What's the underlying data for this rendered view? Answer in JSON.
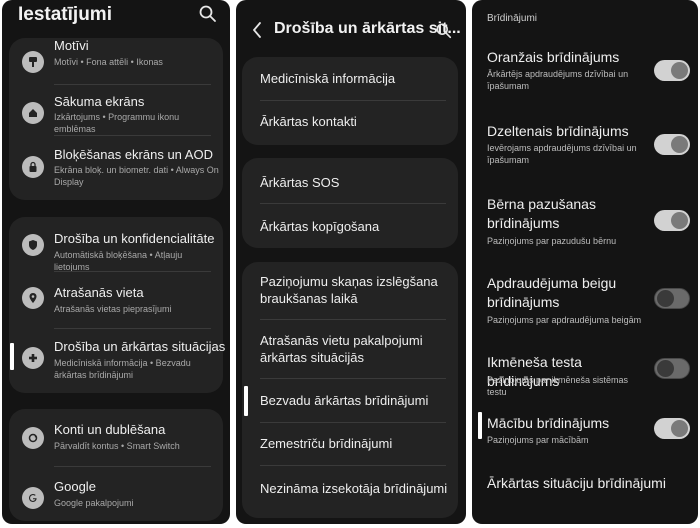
{
  "panel1": {
    "header": "Iestatījumi",
    "items": [
      {
        "title": "Motīvi",
        "sub": "Motīvi  •  Fona attēli  •  Ikonas"
      },
      {
        "title": "Sākuma ekrāns",
        "sub": "Izkārtojums  •  Programmu ikonu emblēmas"
      },
      {
        "title": "Bloķēšanas ekrāns un AOD",
        "sub": "Ekrāna bloķ. un biometr. dati  •  Always On Display"
      },
      {
        "title": "Drošība un konfidencialitāte",
        "sub": "Automātiskā bloķēšana  •  Atļauju lietojums"
      },
      {
        "title": "Atrašanās vieta",
        "sub": "Atrašanās vietas pieprasījumi"
      },
      {
        "title": "Drošība un ārkārtas situācijas",
        "sub": "Medicīniskā informācija  •  Bezvadu ārkārtas brīdinājumi"
      },
      {
        "title": "Konti un dublēšana",
        "sub": "Pārvaldīt kontus  •  Smart Switch"
      },
      {
        "title": "Google",
        "sub": "Google pakalpojumi"
      }
    ]
  },
  "panel2": {
    "title": "Drošība un ārkārtas sit...",
    "rows": [
      "Medicīniskā informācija",
      "Ārkārtas kontakti",
      "Ārkārtas SOS",
      "Ārkārtas kopīgošana",
      "Paziņojumu skaņas izslēgšana braukšanas laikā",
      "Atrašanās vietu pakalpojumi ārkārtas situācijās",
      "Bezvadu ārkārtas brīdinājumi",
      "Zemestrīču brīdinājumi",
      "Nezināma izsekotāja brīdinājumi"
    ]
  },
  "panel3": {
    "section": "Brīdinājumi",
    "items": [
      {
        "title": "Oranžais brīdinājums",
        "sub": "Ārkārtējs apdraudējums dzīvībai un īpašumam",
        "on": true
      },
      {
        "title": "Dzeltenais brīdinājums",
        "sub": "Ievērojams apdraudējums dzīvībai un īpašumam",
        "on": true
      },
      {
        "title": "Bērna pazušanas brīdinājums",
        "sub": "Paziņojums par pazudušu bērnu",
        "on": true
      },
      {
        "title": "Apdraudējuma beigu brīdinājums",
        "sub": "Paziņojums par apdraudējuma beigām",
        "on": false
      },
      {
        "title": "Ikmēneša testa brīdinājums",
        "sub": "Paziņojums par ikmēneša sistēmas testu",
        "on": false
      },
      {
        "title": "Mācību brīdinājums",
        "sub": "Paziņojums par mācībām",
        "on": true
      }
    ],
    "footer": "Ārkārtas situāciju brīdinājumi"
  }
}
